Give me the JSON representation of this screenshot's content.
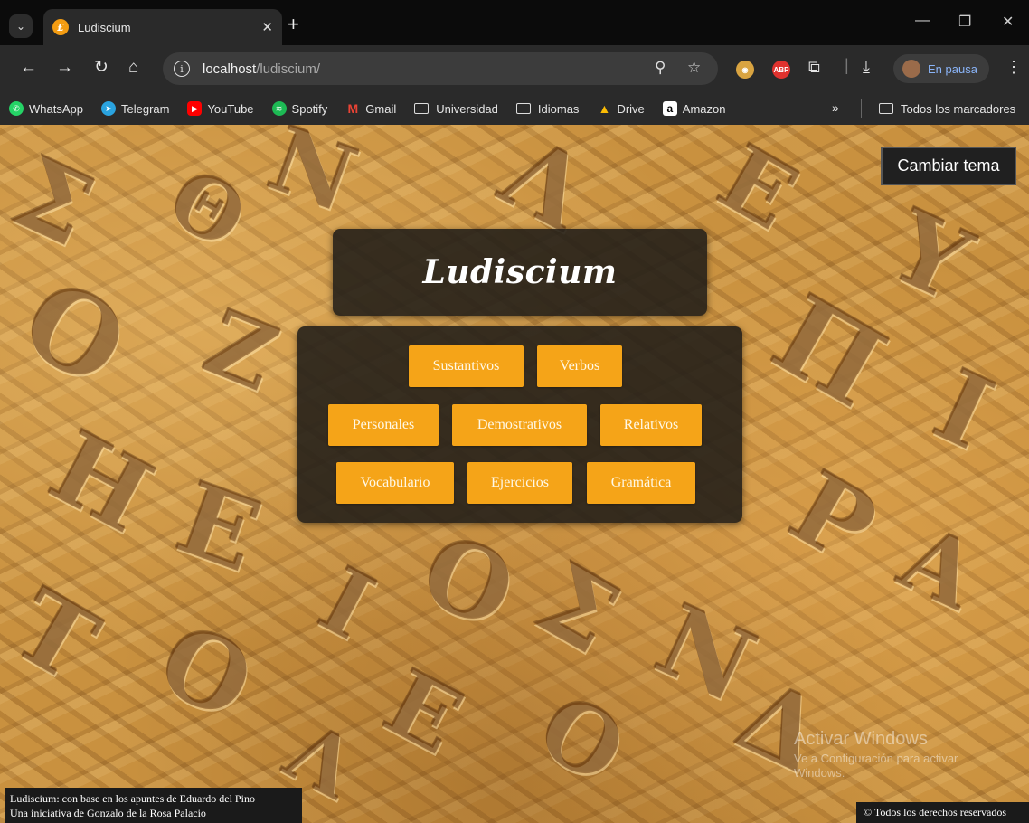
{
  "browser": {
    "tab_title": "Ludiscium",
    "tab_favicon": "£",
    "url_host": "localhost",
    "url_path": "/ludiscium/",
    "profile_label": "En pausa",
    "ext_abp": "ABP",
    "bookmarks": [
      {
        "label": "WhatsApp",
        "icon": "whatsapp-icon",
        "color": "#25d366"
      },
      {
        "label": "Telegram",
        "icon": "telegram-icon",
        "color": "#2aa3df"
      },
      {
        "label": "YouTube",
        "icon": "youtube-icon",
        "color": "#ff0000"
      },
      {
        "label": "Spotify",
        "icon": "spotify-icon",
        "color": "#1db954"
      },
      {
        "label": "Gmail",
        "icon": "gmail-icon",
        "color": "#ea4335"
      },
      {
        "label": "Universidad",
        "icon": "folder-icon",
        "color": ""
      },
      {
        "label": "Idiomas",
        "icon": "folder-icon",
        "color": ""
      },
      {
        "label": "Drive",
        "icon": "drive-icon",
        "color": "#fbbc04"
      },
      {
        "label": "Amazon",
        "icon": "amazon-icon",
        "color": "#ffffff"
      }
    ],
    "all_bookmarks": "Todos los marcadores"
  },
  "page": {
    "theme_button": "Cambiar tema",
    "title": "Ludiscium",
    "menu": [
      [
        "Sustantivos",
        "Verbos"
      ],
      [
        "Personales",
        "Demostrativos",
        "Relativos"
      ],
      [
        "Vocabulario",
        "Ejercicios",
        "Gramática"
      ]
    ],
    "watermark_line1": "Activar Windows",
    "watermark_line2": "Ve a Configuración para activar Windows.",
    "footer_line1": "Ludiscium: con base en los apuntes de Eduardo del Pino",
    "footer_line2": "Una iniciativa de Gonzalo de la Rosa Palacio",
    "copyright": "© Todos los derechos reservados"
  },
  "colors": {
    "button_bg": "#f5a418",
    "card_bg": "#201c18",
    "stone": "#c9913f"
  }
}
